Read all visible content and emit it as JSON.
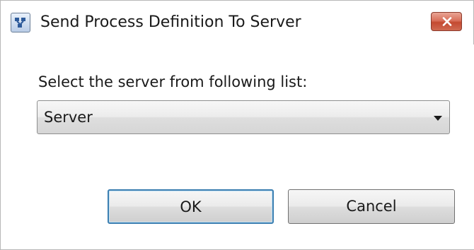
{
  "window": {
    "title": "Send Process Definition To Server"
  },
  "dialog": {
    "prompt": "Select the server from following list:",
    "server_select": {
      "selected": "Server"
    },
    "ok_label": "OK",
    "cancel_label": "Cancel"
  },
  "icons": {
    "app": "process-app-icon",
    "close": "close-icon",
    "dropdown": "chevron-down-icon"
  },
  "colors": {
    "close_button": "#c44a31",
    "focus_border": "#3c7fb1"
  }
}
